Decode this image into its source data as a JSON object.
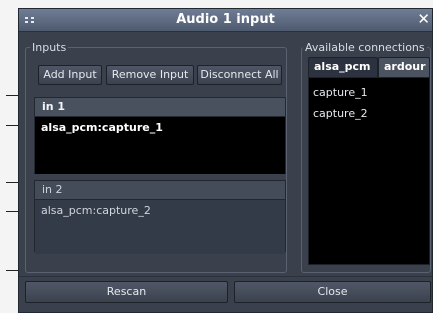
{
  "window": {
    "title": "Audio 1 input",
    "close_glyph": "✕"
  },
  "inputs_group": {
    "label": "Inputs",
    "buttons": {
      "add": "Add Input",
      "remove": "Remove Input",
      "disconnect": "Disconnect All"
    },
    "ports": [
      {
        "name": "in 1",
        "connection": "alsa_pcm:capture_1"
      },
      {
        "name": "in 2",
        "connection": "alsa_pcm:capture_2"
      }
    ]
  },
  "available_group": {
    "label": "Available connections",
    "tabs": [
      "alsa_pcm",
      "ardour"
    ],
    "items": [
      "capture_1",
      "capture_2"
    ]
  },
  "footer": {
    "rescan": "Rescan",
    "close": "Close"
  },
  "icons": {
    "window_menu": "window-menu-icon",
    "close": "close-icon"
  },
  "colors": {
    "titlebar": "#5f6c82",
    "background": "#3a414c",
    "selected": "#000000"
  }
}
